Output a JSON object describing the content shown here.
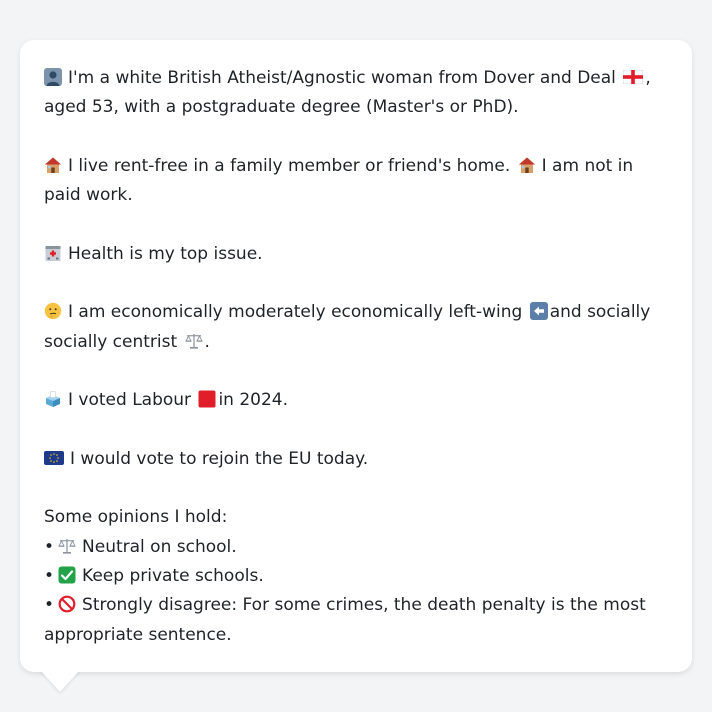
{
  "colors": {
    "background": "#f3f4f6",
    "bubble": "#ffffff",
    "text": "#1f2328",
    "labour_red": "#e11d2a",
    "check_green": "#22a34a",
    "eu_blue": "#1e3a8a"
  },
  "profile": {
    "line1": {
      "icon": "person-silhouette-icon",
      "text_a": "I'm a white British Atheist/Agnostic woman from Dover and Deal",
      "flag": "england-flag-icon",
      "text_b": ", aged 53, with a postgraduate degree (Master's or PhD)."
    },
    "line2": {
      "icon1": "house-icon",
      "text_a": "I live rent-free in a family member or friend's home.",
      "icon2": "house-icon",
      "text_b": "I am not in paid work."
    },
    "line3": {
      "icon": "hospital-icon",
      "text": "Health is my top issue."
    },
    "line4": {
      "icon": "thinking-face-icon",
      "text_a": "I am economically moderately economically left-wing",
      "icon2": "left-arrow-icon",
      "text_b": "and socially socially centrist",
      "icon3": "scales-icon",
      "text_c": "."
    },
    "line5": {
      "icon": "ballot-box-icon",
      "text_a": "I voted Labour",
      "icon2": "red-square-icon",
      "text_b": "in 2024."
    },
    "line6": {
      "icon": "eu-flag-icon",
      "text": "I would vote to rejoin the EU today."
    },
    "opinions_header": "Some opinions I hold:",
    "opinions": [
      {
        "bullet": "•",
        "icon": "scales-icon",
        "text": "Neutral on school."
      },
      {
        "bullet": "•",
        "icon": "check-mark-icon",
        "text": "Keep private schools."
      },
      {
        "bullet": "•",
        "icon": "prohibited-icon",
        "text": "Strongly disagree: For some crimes, the death penalty is the most appropriate sentence."
      }
    ]
  }
}
